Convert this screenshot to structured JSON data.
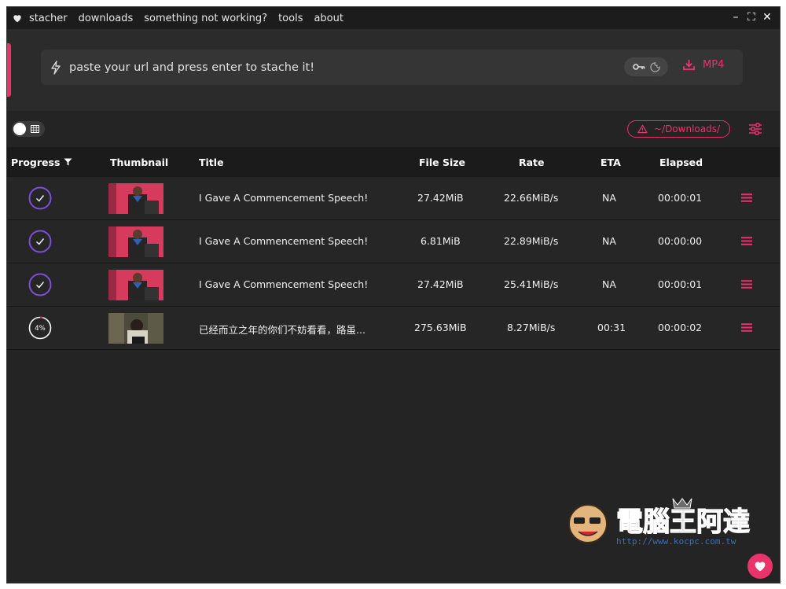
{
  "menu": {
    "items": [
      "stacher",
      "downloads",
      "something not working?",
      "tools",
      "about"
    ]
  },
  "window_controls": [
    "minimize",
    "maximize",
    "close"
  ],
  "url_bar": {
    "placeholder": "paste your url and press enter to stache it!",
    "format_label": "MP4"
  },
  "controls": {
    "download_path": "~/Downloads/"
  },
  "table": {
    "columns": [
      "Progress",
      "Thumbnail",
      "Title",
      "File Size",
      "Rate",
      "ETA",
      "Elapsed"
    ],
    "rows": [
      {
        "status": "complete",
        "title": "I Gave A Commencement Speech!",
        "size": "27.42MiB",
        "rate": "22.66MiB/s",
        "eta": "NA",
        "elapsed": "00:00:01"
      },
      {
        "status": "complete",
        "title": "I Gave A Commencement Speech!",
        "size": "6.81MiB",
        "rate": "22.89MiB/s",
        "eta": "NA",
        "elapsed": "00:00:00"
      },
      {
        "status": "complete",
        "title": "I Gave A Commencement Speech!",
        "size": "27.42MiB",
        "rate": "25.41MiB/s",
        "eta": "NA",
        "elapsed": "00:00:01"
      },
      {
        "status": "downloading",
        "progress_label": "4%",
        "progress": 0.04,
        "title": "已经而立之年的你们不妨看看，路虽...",
        "size": "275.63MiB",
        "rate": "8.27MiB/s",
        "eta": "00:31",
        "elapsed": "00:00:02"
      }
    ]
  },
  "watermark": {
    "title": "電腦王阿達",
    "url": "http://www.kocpc.com.tw"
  },
  "colors": {
    "accent": "#e8336b",
    "complete_ring": "#7b4fd6",
    "background": "#242424"
  }
}
